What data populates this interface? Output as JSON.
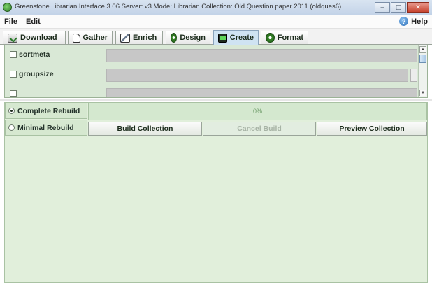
{
  "window": {
    "title": "Greenstone Librarian Interface 3.06  Server: v3  Mode: Librarian  Collection: Old Question paper 2011 (oldques6)",
    "icons": {
      "app": "greenstone-app-icon",
      "minimize": "minimize-icon",
      "maximize": "maximize-icon",
      "close": "close-icon"
    },
    "controls": {
      "minimize": "–",
      "maximize": "▢",
      "close": "✕"
    }
  },
  "menu": {
    "items": [
      "File",
      "Edit"
    ],
    "help_label": "Help",
    "help_glyph": "?"
  },
  "tabs": [
    {
      "label": "Download",
      "icon": "download-icon"
    },
    {
      "label": "Gather",
      "icon": "gather-icon"
    },
    {
      "label": "Enrich",
      "icon": "enrich-icon"
    },
    {
      "label": "Design",
      "icon": "design-icon"
    },
    {
      "label": "Create",
      "icon": "create-icon",
      "active": true
    },
    {
      "label": "Format",
      "icon": "format-icon"
    }
  ],
  "options": [
    {
      "label": "sortmeta",
      "checked": false,
      "value": ""
    },
    {
      "label": "groupsize",
      "checked": false,
      "value": ""
    }
  ],
  "build": {
    "modes": [
      {
        "label": "Complete Rebuild",
        "selected": true
      },
      {
        "label": "Minimal Rebuild",
        "selected": false
      }
    ],
    "progress_text": "0%",
    "progress_fraction": 0,
    "buttons": {
      "build": "Build Collection",
      "cancel": "Cancel Build",
      "preview": "Preview Collection"
    }
  },
  "colors": {
    "panel_green": "#e1efdb",
    "active_tab": "#cfe3f2"
  }
}
